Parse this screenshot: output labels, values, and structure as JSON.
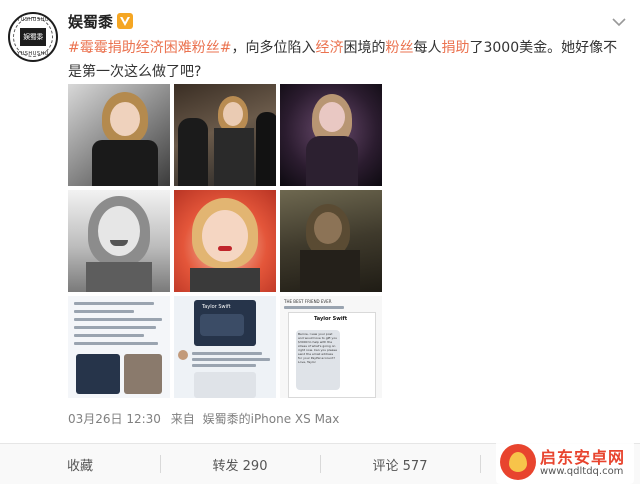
{
  "user": {
    "name": "娱蜀黍",
    "avatar_seal_text": "娱蜀黍",
    "avatar_ring_text_top": "YUSHUSHU",
    "avatar_ring_text_bottom": "YUSHUSHU",
    "verified_color": "#f5a623"
  },
  "post": {
    "hashtag": "#霉霉捐助经济困难粉丝#",
    "text_1": "，向多位陷入",
    "link_1": "经济",
    "text_2": "困境的",
    "link_2": "粉丝",
    "text_3": "每人",
    "link_3": "捐助",
    "text_4": "了3000美金。她好像不是第一次这么做了吧?",
    "link_color": "#eb7350"
  },
  "images": [
    {
      "name": "photo-1"
    },
    {
      "name": "photo-2"
    },
    {
      "name": "photo-3"
    },
    {
      "name": "photo-4"
    },
    {
      "name": "photo-5"
    },
    {
      "name": "photo-6"
    },
    {
      "name": "screenshot-7"
    },
    {
      "name": "screenshot-8"
    },
    {
      "name": "screenshot-9"
    }
  ],
  "screenshots": {
    "s8_title": "Taylor Swift",
    "s9_caption": "THE BEST FRIEND EVER",
    "s9_title": "Taylor Swift",
    "s9_msg": "Bernie, I saw your post and would love to gift you $3000 to help with the stress of what's going on right now. Can you please send the email address for your PayPal account? Love, Taylor"
  },
  "meta": {
    "date": "03月26日 12:30",
    "from_label": "来自",
    "source": "娱蜀黍的iPhone XS Max"
  },
  "footer": {
    "collect": "收藏",
    "repost": "转发 290",
    "comment": "评论 577"
  },
  "watermark": {
    "title": "启东安卓网",
    "url": "www.qdltdq.com"
  }
}
